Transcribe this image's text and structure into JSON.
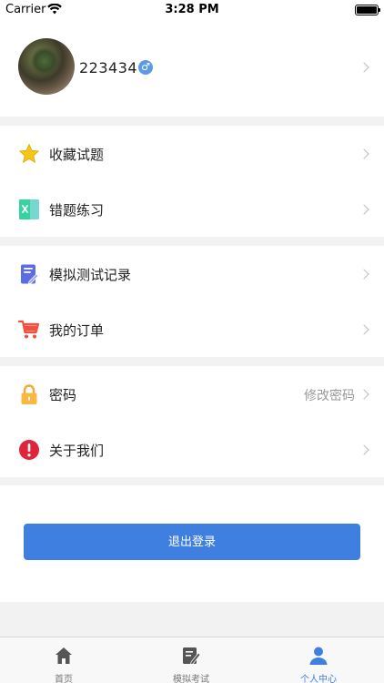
{
  "status_bar": {
    "carrier": "Carrier",
    "time": "3:28 PM"
  },
  "profile": {
    "username": "223434",
    "gender_symbol": "♂"
  },
  "menu_groups": [
    {
      "items": [
        {
          "label": "收藏试题",
          "icon": "star-icon"
        },
        {
          "label": "错题练习",
          "icon": "wrong-answer-icon"
        }
      ]
    },
    {
      "items": [
        {
          "label": "模拟测试记录",
          "icon": "test-record-icon"
        },
        {
          "label": "我的订单",
          "icon": "cart-icon"
        }
      ]
    },
    {
      "items": [
        {
          "label": "密码",
          "value": "修改密码",
          "icon": "lock-icon"
        },
        {
          "label": "关于我们",
          "icon": "alert-icon"
        }
      ]
    }
  ],
  "logout": {
    "label": "退出登录"
  },
  "tabbar": {
    "tabs": [
      {
        "label": "首页",
        "icon": "home-icon"
      },
      {
        "label": "模拟考试",
        "icon": "exam-icon"
      },
      {
        "label": "个人中心",
        "icon": "profile-icon"
      }
    ],
    "active_index": 2
  },
  "colors": {
    "accent": "#3f7fe0",
    "background": "#f2f2f2"
  }
}
